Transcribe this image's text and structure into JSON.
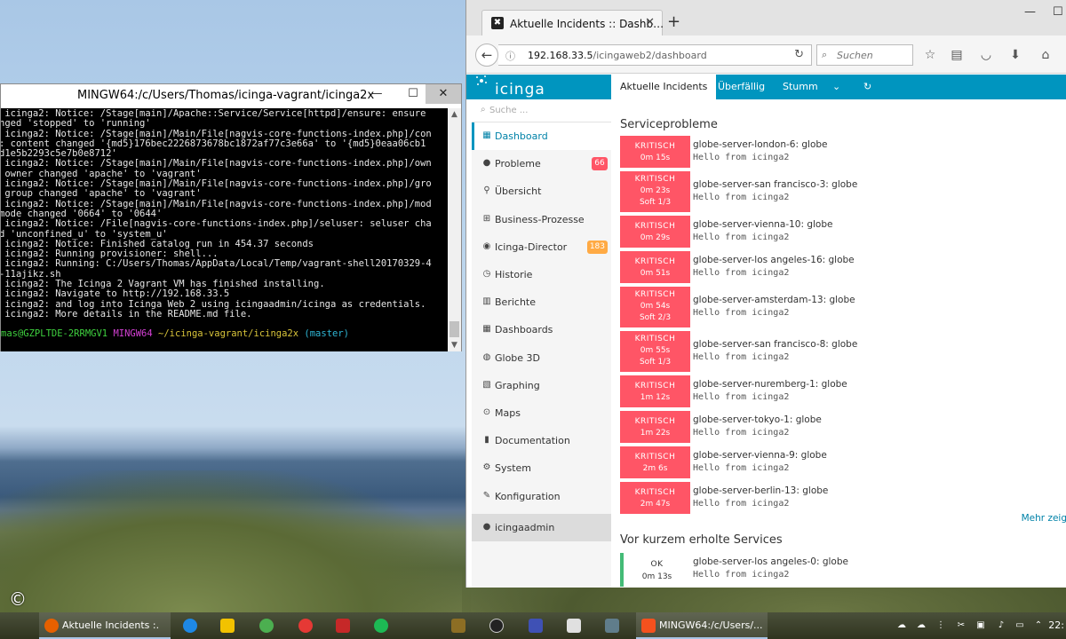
{
  "terminal": {
    "title": "MINGW64:/c/Users/Thomas/icinga-vagrant/icinga2x",
    "lines": [
      " icinga2: Notice: /Stage[main]/Apache::Service/Service[httpd]/ensure: ensure",
      "nged 'stopped' to 'running'",
      " icinga2: Notice: /Stage[main]/Main/File[nagvis-core-functions-index.php]/con",
      ": content changed '{md5}176bec2226873678bc1872af77c3e66a' to '{md5}0eaa06cb1",
      "d1e5b2293c5e7b0e8712'",
      " icinga2: Notice: /Stage[main]/Main/File[nagvis-core-functions-index.php]/own",
      " owner changed 'apache' to 'vagrant'",
      " icinga2: Notice: /Stage[main]/Main/File[nagvis-core-functions-index.php]/gro",
      " group changed 'apache' to 'vagrant'",
      " icinga2: Notice: /Stage[main]/Main/File[nagvis-core-functions-index.php]/mod",
      "mode changed '0664' to '0644'",
      " icinga2: Notice: /File[nagvis-core-functions-index.php]/seluser: seluser cha",
      "d 'unconfined_u' to 'system_u'",
      " icinga2: Notice: Finished catalog run in 454.37 seconds",
      " icinga2: Running provisioner: shell...",
      " icinga2: Running: C:/Users/Thomas/AppData/Local/Temp/vagrant-shell20170329-4",
      "-11ajikz.sh",
      " icinga2: The Icinga 2 Vagrant VM has finished installing.",
      " icinga2: Navigate to http://192.168.33.5",
      " icinga2: and log into Icinga Web 2 using icingaadmin/icinga as credentials.",
      " icinga2: More details in the README.md file."
    ],
    "prompt": {
      "user": "mas@GZPLTDE-2RRMGV1",
      "system": "MINGW64",
      "path": "~/icinga-vagrant/icinga2x",
      "branch": "(master)"
    }
  },
  "browser": {
    "tab_title": "Aktuelle Incidents :: Dashb…",
    "url_host": "192.168.33.5",
    "url_path": "/icingaweb2/dashboard",
    "search_placeholder": "Suchen"
  },
  "icinga": {
    "logo": "icinga",
    "tabs": [
      {
        "label": "Aktuelle Incidents",
        "active": true
      },
      {
        "label": "Überfällig",
        "active": false
      },
      {
        "label": "Stumm",
        "active": false
      }
    ],
    "search_placeholder": "Suche ...",
    "sidebar": [
      {
        "label": "Dashboard",
        "icon": "dashboard-icon",
        "active": true
      },
      {
        "label": "Probleme",
        "icon": "problems-icon",
        "badge": "66",
        "badge_color": "#ff5566"
      },
      {
        "label": "Übersicht",
        "icon": "binoculars-icon"
      },
      {
        "label": "Business-Prozesse",
        "icon": "sitemap-icon"
      },
      {
        "label": "Icinga-Director",
        "icon": "director-icon",
        "badge": "183",
        "badge_color": "#ffaa44"
      },
      {
        "label": "Historie",
        "icon": "history-icon"
      },
      {
        "label": "Berichte",
        "icon": "reports-icon"
      },
      {
        "label": "Dashboards",
        "icon": "dashboards-icon"
      },
      {
        "label": "Globe 3D",
        "icon": "globe-icon"
      },
      {
        "label": "Graphing",
        "icon": "graphing-icon"
      },
      {
        "label": "Maps",
        "icon": "maps-icon"
      },
      {
        "label": "Documentation",
        "icon": "documentation-icon"
      },
      {
        "label": "System",
        "icon": "system-icon"
      },
      {
        "label": "Konfiguration",
        "icon": "wrench-icon"
      },
      {
        "label": "icingaadmin",
        "icon": "user-icon",
        "user": true
      }
    ],
    "service_problems_title": "Serviceprobleme",
    "problems": [
      {
        "state": "KRITISCH",
        "duration": "0m 15s",
        "soft": "",
        "host": "globe-server-london-6: globe",
        "output": "Hello from icinga2"
      },
      {
        "state": "KRITISCH",
        "duration": "0m 23s",
        "soft": "Soft 1/3",
        "host": "globe-server-san francisco-3: globe",
        "output": "Hello from icinga2"
      },
      {
        "state": "KRITISCH",
        "duration": "0m 29s",
        "soft": "",
        "host": "globe-server-vienna-10: globe",
        "output": "Hello from icinga2"
      },
      {
        "state": "KRITISCH",
        "duration": "0m 51s",
        "soft": "",
        "host": "globe-server-los angeles-16: globe",
        "output": "Hello from icinga2"
      },
      {
        "state": "KRITISCH",
        "duration": "0m 54s",
        "soft": "Soft 2/3",
        "host": "globe-server-amsterdam-13: globe",
        "output": "Hello from icinga2"
      },
      {
        "state": "KRITISCH",
        "duration": "0m 55s",
        "soft": "Soft 1/3",
        "host": "globe-server-san francisco-8: globe",
        "output": "Hello from icinga2"
      },
      {
        "state": "KRITISCH",
        "duration": "1m 12s",
        "soft": "",
        "host": "globe-server-nuremberg-1: globe",
        "output": "Hello from icinga2"
      },
      {
        "state": "KRITISCH",
        "duration": "1m 22s",
        "soft": "",
        "host": "globe-server-tokyo-1: globe",
        "output": "Hello from icinga2"
      },
      {
        "state": "KRITISCH",
        "duration": "2m 6s",
        "soft": "",
        "host": "globe-server-vienna-9: globe",
        "output": "Hello from icinga2"
      },
      {
        "state": "KRITISCH",
        "duration": "2m 47s",
        "soft": "",
        "host": "globe-server-berlin-13: globe",
        "output": "Hello from icinga2"
      }
    ],
    "more_link": "Mehr zeig",
    "recovered_title": "Vor kurzem erholte Services",
    "recovered": [
      {
        "state": "OK",
        "duration": "0m 13s",
        "host": "globe-server-los angeles-0: globe",
        "output": "Hello from icinga2"
      }
    ],
    "colors": {
      "brand": "#0095bf",
      "critical": "#ff5566",
      "ok": "#44bb77",
      "warning": "#ffaa44"
    }
  },
  "taskbar": {
    "tasks": [
      {
        "label": "Aktuelle Incidents :.",
        "icon": "firefox-icon"
      },
      {
        "label": "MINGW64:/c/Users/...",
        "icon": "git-bash-icon"
      }
    ],
    "clock": "22:"
  },
  "desktop": {
    "copyright_mark": "©"
  }
}
